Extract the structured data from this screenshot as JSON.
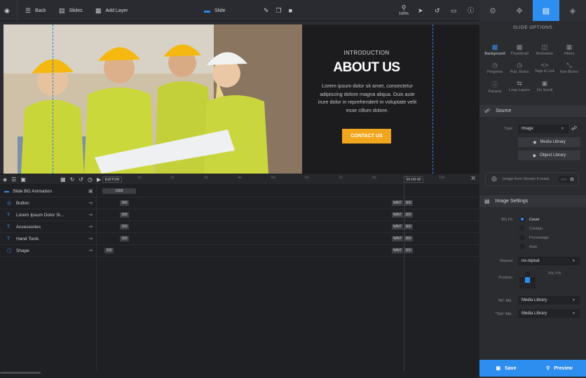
{
  "topbar": {
    "back_label": "Back",
    "slides_label": "Slides",
    "add_layer_label": "Add Layer",
    "slide_label": "Slide",
    "zoom": "100%"
  },
  "slide": {
    "intro": "INTRODUCTION",
    "heading": "ABOUT US",
    "body": "Lorem ipsum dolor sit amet, consectetur adipiscing dolore magna aliqua. Duis aute irure dolor in reprehenderit in voluptate velit esse cillum dolore.",
    "cta": "CONTACT US"
  },
  "timeline": {
    "editor_label": "EDITOR",
    "ticks": [
      "1s",
      "2s",
      "3s",
      "4s",
      "5s",
      "6s",
      "7s",
      "8s",
      "9s",
      "10s"
    ],
    "current_time": "00:09:00",
    "rows": [
      {
        "name": "Slide BG Animation",
        "icon": "slide-icon",
        "chip": "1000"
      },
      {
        "name": "Button",
        "icon": "button-icon",
        "chip": "300",
        "wait": "WAIT",
        "end": "300"
      },
      {
        "name": "Lorem Ipsum Dolor Si...",
        "icon": "text-icon",
        "chip": "300",
        "wait": "WAIT",
        "end": "300"
      },
      {
        "name": "Accessories",
        "icon": "text-icon",
        "chip": "300",
        "wait": "WAIT",
        "end": "300"
      },
      {
        "name": "Hand Tools",
        "icon": "text-icon",
        "chip": "300",
        "wait": "WAIT",
        "end": "300"
      },
      {
        "name": "Shape",
        "icon": "shape-icon",
        "chip": "300",
        "wait": "WAIT",
        "end": "300"
      }
    ]
  },
  "panel": {
    "title": "SLIDE OPTIONS",
    "options": [
      "Background",
      "Thumbnail",
      "Animation",
      "Filters",
      "Progress",
      "Pub. Rules",
      "Tags & Link",
      "Ken Burns",
      "Params",
      "Loop Layers",
      "On Scroll"
    ],
    "source": {
      "title": "Source",
      "type_label": "Type",
      "type_value": "Image",
      "media_library": "Media Library",
      "object_library": "Object Library",
      "stream_label": "Image from Stream if exists",
      "stream_toggle": "OFF"
    },
    "image_settings": {
      "title": "Image Settings",
      "bgfit_label": "BG Fit",
      "fit_options": [
        "Cover",
        "Contain",
        "Percentage",
        "Auto"
      ],
      "repeat_label": "Repeat",
      "repeat_value": "no-repeat",
      "position_label": "Position",
      "xy_label": "X% Y%",
      "alt_label": "\"Alt\" Attr.",
      "alt_value": "Media Library",
      "title_label": "\"Title\" Attr.",
      "title_value": "Media Library"
    },
    "save_label": "Save",
    "preview_label": "Preview"
  },
  "colors": {
    "accent": "#2d8ef0",
    "cta": "#f2a61e",
    "timeline_icon": "#3a8ae8"
  }
}
